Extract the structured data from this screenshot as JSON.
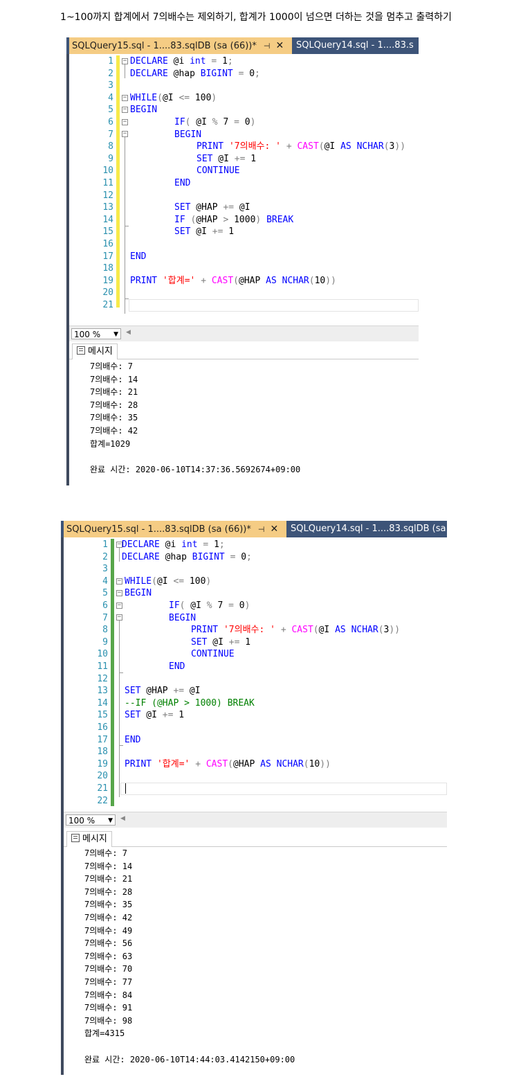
{
  "header": "1~100까지 합계에서 7의배수는 제외하기, 합계가 1000이 넘으면 더하는 것을 멈추고 출력하기",
  "panel1": {
    "tab_active": "SQLQuery15.sql - 1....83.sqlDB (sa (66))*",
    "tab_inactive": "SQLQuery14.sql - 1....83.s",
    "line_numbers": [
      "1",
      "2",
      "3",
      "4",
      "5",
      "6",
      "7",
      "8",
      "9",
      "10",
      "11",
      "12",
      "13",
      "14",
      "15",
      "16",
      "17",
      "18",
      "19",
      "20",
      "21"
    ],
    "code": {
      "l1": "DECLARE @i int = 1;",
      "l2": "DECLARE @hap BIGINT = 0;",
      "l4": "WHILE(@I <= 100)",
      "l5": "BEGIN",
      "l6": "IF( @I % 7 = 0)",
      "l7": "BEGIN",
      "l8": "PRINT '7의배수: ' + CAST(@I AS NCHAR(3))",
      "l9": "SET @I += 1",
      "l10": "CONTINUE",
      "l11": "END",
      "l13": "SET @HAP += @I",
      "l14": "IF (@HAP > 1000) BREAK",
      "l15": "SET @I += 1",
      "l17": "END",
      "l19": "PRINT '합계=' + CAST(@HAP AS NCHAR(10))"
    },
    "zoom": "100 %",
    "messages_tab": "메시지",
    "output": [
      "7의배수: 7",
      "7의배수: 14",
      "7의배수: 21",
      "7의배수: 28",
      "7의배수: 35",
      "7의배수: 42",
      "합계=1029",
      "",
      "완료 시간: 2020-06-10T14:37:36.5692674+09:00"
    ]
  },
  "panel2": {
    "tab_active": "SQLQuery15.sql - 1....83.sqlDB (sa (66))*",
    "tab_inactive": "SQLQuery14.sql - 1....83.sqlDB (sa",
    "line_numbers": [
      "1",
      "2",
      "3",
      "4",
      "5",
      "6",
      "7",
      "8",
      "9",
      "10",
      "11",
      "12",
      "13",
      "14",
      "15",
      "16",
      "17",
      "18",
      "19",
      "20",
      "21",
      "22"
    ],
    "code": {
      "l1": "DECLARE @i int = 1;",
      "l2": "DECLARE @hap BIGINT = 0;",
      "l4": "WHILE(@I <= 100)",
      "l5": "BEGIN",
      "l6": "IF( @I % 7 = 0)",
      "l7": "BEGIN",
      "l8": "PRINT '7의배수: ' + CAST(@I AS NCHAR(3))",
      "l9": "SET @I += 1",
      "l10": "CONTINUE",
      "l11": "END",
      "l13": "SET @HAP += @I",
      "l14": "--IF (@HAP > 1000) BREAK",
      "l15": "SET @I += 1",
      "l17": "END",
      "l19": "PRINT '합계=' + CAST(@HAP AS NCHAR(10))"
    },
    "zoom": "100 %",
    "messages_tab": "메시지",
    "output": [
      "7의배수: 7",
      "7의배수: 14",
      "7의배수: 21",
      "7의배수: 28",
      "7의배수: 35",
      "7의배수: 42",
      "7의배수: 49",
      "7의배수: 56",
      "7의배수: 63",
      "7의배수: 70",
      "7의배수: 77",
      "7의배수: 84",
      "7의배수: 91",
      "7의배수: 98",
      "합계=4315",
      "",
      "완료 시간: 2020-06-10T14:44:03.4142150+09:00"
    ]
  },
  "colors": {
    "tab_active_bg": "#f5cc84",
    "tab_bar_bg": "#3d5478",
    "keyword": "#0000ff",
    "function": "#ff00ff",
    "string": "#ff0000",
    "comment": "#008000",
    "line_number": "#2b91af",
    "changed_marker": "#f7ea4a",
    "saved_marker": "#57a64a"
  }
}
